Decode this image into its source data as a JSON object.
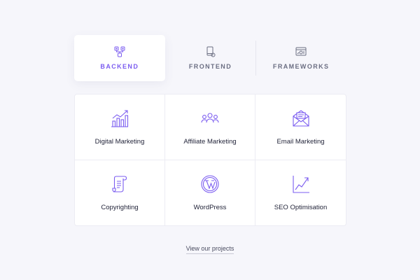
{
  "tabs": [
    {
      "label": "BACKEND",
      "icon": "server-icon",
      "active": true
    },
    {
      "label": "FRONTEND",
      "icon": "devices-icon",
      "active": false
    },
    {
      "label": "FRAMEWORKS",
      "icon": "browser-settings-icon",
      "active": false
    }
  ],
  "services": [
    {
      "label": "Digital Marketing",
      "icon": "bar-chart-icon"
    },
    {
      "label": "Affiliate Marketing",
      "icon": "people-group-icon"
    },
    {
      "label": "Email Marketing",
      "icon": "envelope-icon"
    },
    {
      "label": "Copyrighting",
      "icon": "scroll-icon"
    },
    {
      "label": "WordPress",
      "icon": "wordpress-icon"
    },
    {
      "label": "SEO Optimisation",
      "icon": "line-chart-icon"
    }
  ],
  "footer": {
    "link_label": "View our projects"
  },
  "colors": {
    "accent": "#7b5cf0",
    "text": "#23253a",
    "muted": "#6b6e82",
    "background": "#f6f6fb"
  }
}
